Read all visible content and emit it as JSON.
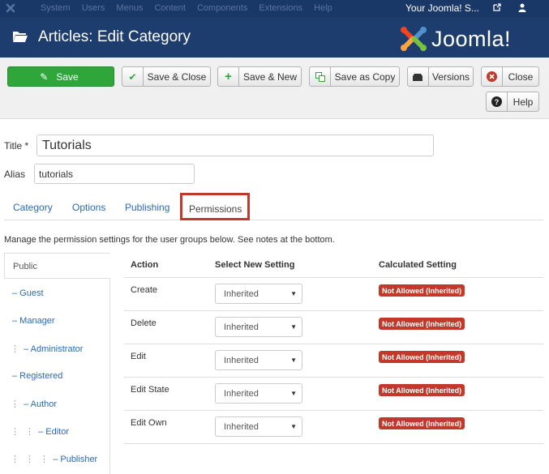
{
  "topnav": {
    "menu": [
      "System",
      "Users",
      "Menus",
      "Content",
      "Components",
      "Extensions",
      "Help"
    ],
    "site_link": "Your Joomla! S...",
    "icons": [
      "joomla-icon",
      "external-link-icon",
      "user-icon"
    ]
  },
  "header": {
    "title": "Articles: Edit Category",
    "brand": "Joomla!",
    "icon": "folder-icon"
  },
  "toolbar": {
    "save": "Save",
    "save_close": "Save & Close",
    "save_new": "Save & New",
    "save_copy": "Save as Copy",
    "versions": "Versions",
    "close": "Close",
    "help": "Help"
  },
  "form": {
    "title_label": "Title *",
    "title_value": "Tutorials",
    "alias_label": "Alias",
    "alias_value": "tutorials"
  },
  "tabs": [
    "Category",
    "Options",
    "Publishing",
    "Permissions"
  ],
  "active_tab": "Permissions",
  "description": "Manage the permission settings for the user groups below. See notes at the bottom.",
  "groups": [
    {
      "label": "Public",
      "prefix": ""
    },
    {
      "label": "– Guest",
      "prefix": ""
    },
    {
      "label": "– Manager",
      "prefix": ""
    },
    {
      "label": "– Administrator",
      "prefix": "⋮"
    },
    {
      "label": "– Registered",
      "prefix": ""
    },
    {
      "label": "– Author",
      "prefix": "⋮"
    },
    {
      "label": "– Editor",
      "prefix": "⋮ ⋮"
    },
    {
      "label": "– Publisher",
      "prefix": "⋮ ⋮ ⋮"
    }
  ],
  "table": {
    "headers": [
      "Action",
      "Select New Setting",
      "Calculated Setting"
    ],
    "rows": [
      {
        "action": "Create",
        "setting": "Inherited",
        "calculated": "Not Allowed (Inherited)"
      },
      {
        "action": "Delete",
        "setting": "Inherited",
        "calculated": "Not Allowed (Inherited)"
      },
      {
        "action": "Edit",
        "setting": "Inherited",
        "calculated": "Not Allowed (Inherited)"
      },
      {
        "action": "Edit State",
        "setting": "Inherited",
        "calculated": "Not Allowed (Inherited)"
      },
      {
        "action": "Edit Own",
        "setting": "Inherited",
        "calculated": "Not Allowed (Inherited)"
      }
    ]
  },
  "colors": {
    "topnav": "#1a3867",
    "header": "#1c3d6e",
    "save_button": "#2fa63a",
    "badge": "#c0392b",
    "link": "#2a69b8"
  }
}
